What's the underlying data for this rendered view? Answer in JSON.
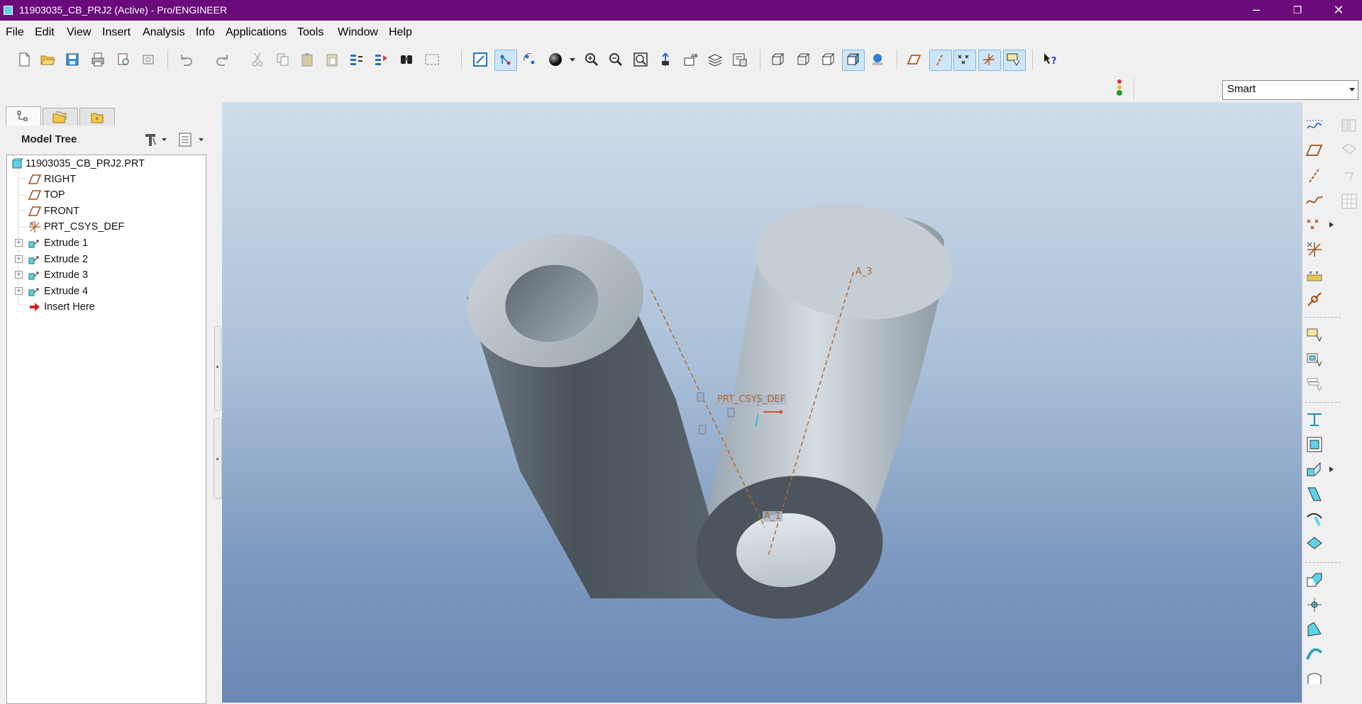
{
  "window": {
    "title": "11903035_CB_PRJ2 (Active) - Pro/ENGINEER",
    "controls": {
      "minimize": "─",
      "restore": "❐",
      "close": "✕"
    }
  },
  "menu": {
    "items": [
      {
        "label": "File"
      },
      {
        "label": "Edit"
      },
      {
        "label": "View"
      },
      {
        "label": "Insert"
      },
      {
        "label": "Analysis"
      },
      {
        "label": "Info"
      },
      {
        "label": "Applications"
      },
      {
        "label": "Tools"
      },
      {
        "label": "Window"
      },
      {
        "label": "Help"
      }
    ]
  },
  "toolbar": {
    "icons": [
      "new-icon",
      "open-icon",
      "save-icon",
      "print-icon",
      "print-preview-icon",
      "email-icon",
      "undo-icon",
      "redo-icon",
      "cut-icon",
      "copy-icon",
      "paste-icon",
      "paste-special-icon",
      "regenerate-icon",
      "regen-manager-icon",
      "find-icon",
      "select-box-icon",
      "repaint-icon",
      "spin-center-icon",
      "orient-mode-icon",
      "appearance-icon",
      "zoom-in-icon",
      "zoom-out-icon",
      "refit-icon",
      "reorient-icon",
      "saved-views-icon",
      "layers-icon",
      "view-manager-icon",
      "wireframe-icon",
      "hidden-line-icon",
      "no-hidden-icon",
      "shading-icon",
      "enhanced-realism-icon",
      "plane-display-icon",
      "axis-display-icon",
      "point-display-icon",
      "csys-display-icon",
      "annotation-display-icon",
      "context-help-icon"
    ]
  },
  "filter": {
    "value": "Smart",
    "status_icon": "traffic-light-icon"
  },
  "panel": {
    "tabs": [
      "model-tree-tab-icon",
      "folder-browser-tab-icon",
      "favorites-tab-icon"
    ],
    "title": "Model Tree",
    "settings_icon": "tree-settings-icon",
    "columns_icon": "tree-columns-icon"
  },
  "tree": {
    "root": {
      "label": "11903035_CB_PRJ2.PRT",
      "icon": "part-icon"
    },
    "items": [
      {
        "label": "RIGHT",
        "icon": "datum-plane-icon",
        "expandable": false
      },
      {
        "label": "TOP",
        "icon": "datum-plane-icon",
        "expandable": false
      },
      {
        "label": "FRONT",
        "icon": "datum-plane-icon",
        "expandable": false
      },
      {
        "label": "PRT_CSYS_DEF",
        "icon": "csys-icon",
        "expandable": false
      },
      {
        "label": "Extrude 1",
        "icon": "extrude-icon",
        "expandable": true
      },
      {
        "label": "Extrude 2",
        "icon": "extrude-icon",
        "expandable": true
      },
      {
        "label": "Extrude 3",
        "icon": "extrude-icon",
        "expandable": true
      },
      {
        "label": "Extrude 4",
        "icon": "extrude-icon",
        "expandable": true
      },
      {
        "label": "Insert Here",
        "icon": "insert-arrow-icon",
        "expandable": false
      }
    ]
  },
  "viewport": {
    "csys_label": "PRT_CSYS_DEF",
    "axis_a3": "A_3",
    "axis_a1": "A_1",
    "colors": {
      "datum": "#c07a3a",
      "bg_top": "#cfdcea",
      "bg_bottom": "#6a88b3"
    }
  },
  "rightbar": {
    "icons": [
      "sketch-tool-icon",
      "datum-plane-tool-icon",
      "datum-axis-tool-icon",
      "datum-curve-tool-icon",
      "datum-point-tool-icon",
      "datum-csys-tool-icon",
      "analysis-feature-icon",
      "copy-geometry-icon",
      "mirror-icon",
      "merge-icon",
      "trim-icon",
      "pattern-icon",
      "extrude-tool-icon",
      "revolve-tool-icon",
      "hole-tool-icon",
      "shell-tool-icon",
      "rib-tool-icon",
      "draft-tool-icon",
      "round-tool-icon",
      "chamfer-tool-icon",
      "swept-blend-icon",
      "variable-sweep-icon",
      "boundary-blend-icon",
      "style-tool-icon",
      "warp-tool-icon"
    ]
  }
}
